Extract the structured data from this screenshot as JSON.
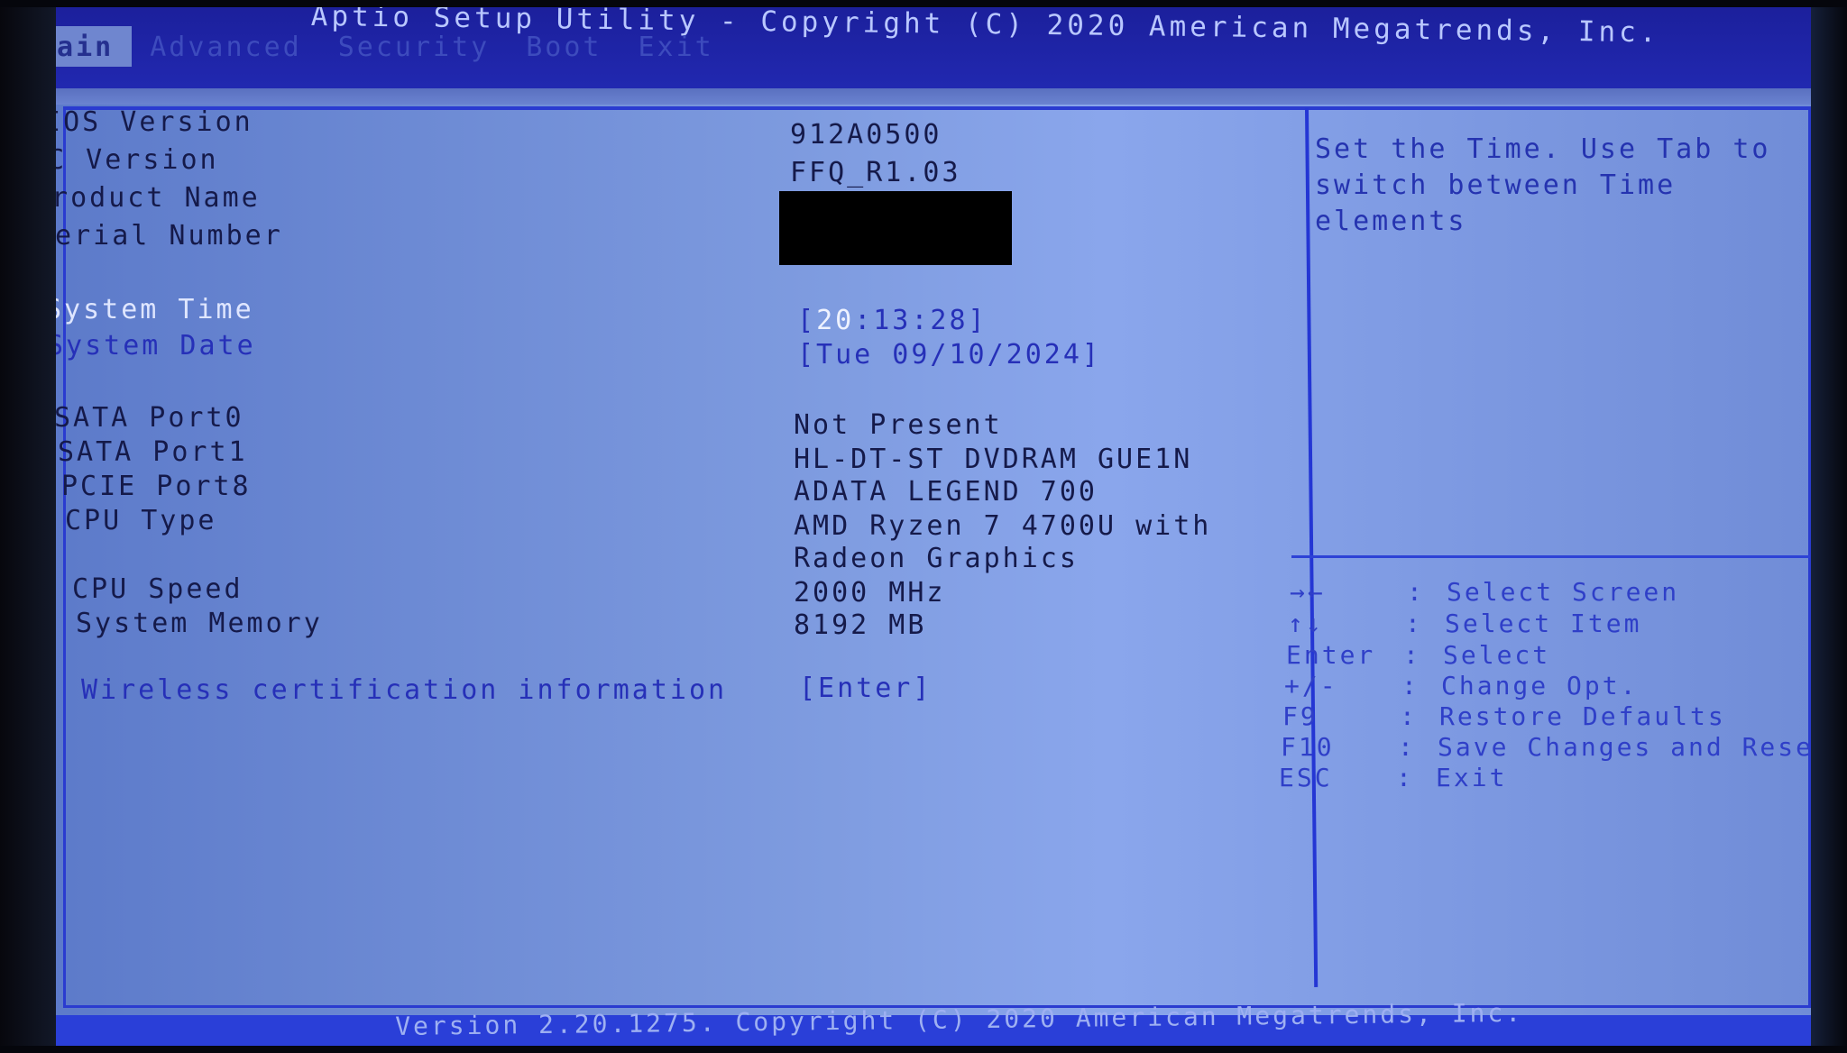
{
  "header": {
    "title": "Aptio Setup Utility - Copyright (C) 2020 American Megatrends, Inc.",
    "tabs": [
      {
        "label": "Main",
        "active": true
      },
      {
        "label": "Advanced",
        "active": false
      },
      {
        "label": "Security",
        "active": false
      },
      {
        "label": "Boot",
        "active": false
      },
      {
        "label": "Exit",
        "active": false
      }
    ]
  },
  "main": {
    "info": [
      {
        "label": "BIOS Version",
        "value": "912A0500"
      },
      {
        "label": "EC Version",
        "value": "FFQ_R1.03"
      },
      {
        "label": "Product Name",
        "value": ""
      },
      {
        "label": "Serial Number",
        "value": ""
      }
    ],
    "system_time": {
      "label": "System Time",
      "value_open": "[",
      "value_hour": "20",
      "value_rest": ":13:28]"
    },
    "system_date": {
      "label": "System Date",
      "value": "[Tue 09/10/2024]"
    },
    "devices": [
      {
        "label": "SATA Port0",
        "value": "Not Present"
      },
      {
        "label": "SATA Port1",
        "value": "HL-DT-ST DVDRAM GUE1N"
      },
      {
        "label": "PCIE Port8",
        "value": "ADATA LEGEND 700"
      },
      {
        "label": "CPU Type",
        "value": "AMD Ryzen 7 4700U with",
        "value2": "Radeon Graphics"
      },
      {
        "label": "CPU Speed",
        "value": "2000 MHz"
      },
      {
        "label": "System Memory",
        "value": "8192 MB"
      }
    ],
    "wireless": {
      "label": "Wireless certification information",
      "value": "[Enter]"
    },
    "redacted": "product name / serial number redacted"
  },
  "help": {
    "text": "Set the Time. Use Tab to switch between Time elements"
  },
  "keys": [
    {
      "key": "→←",
      "icon": "left-right-arrows-icon",
      "sep": ":",
      "action": "Select Screen"
    },
    {
      "key": "↑↓",
      "icon": "up-down-arrows-icon",
      "sep": ":",
      "action": "Select Item"
    },
    {
      "key": "Enter",
      "sep": ":",
      "action": "Select"
    },
    {
      "key": "+/-",
      "sep": ":",
      "action": "Change Opt."
    },
    {
      "key": "F9",
      "sep": ":",
      "action": "Restore Defaults"
    },
    {
      "key": "F10",
      "sep": ":",
      "action": "Save Changes and Reset"
    },
    {
      "key": "ESC",
      "sep": ":",
      "action": "Exit"
    }
  ],
  "footer": {
    "text": "Version 2.20.1275. Copyright (C) 2020 American Megatrends, Inc."
  },
  "colors": {
    "header_bg": "#2128b0",
    "panel_bg": "#7f9ce0",
    "border": "#2a3bd0",
    "selectable_text": "#2630b8",
    "highlight_text": "#eef2ff"
  }
}
